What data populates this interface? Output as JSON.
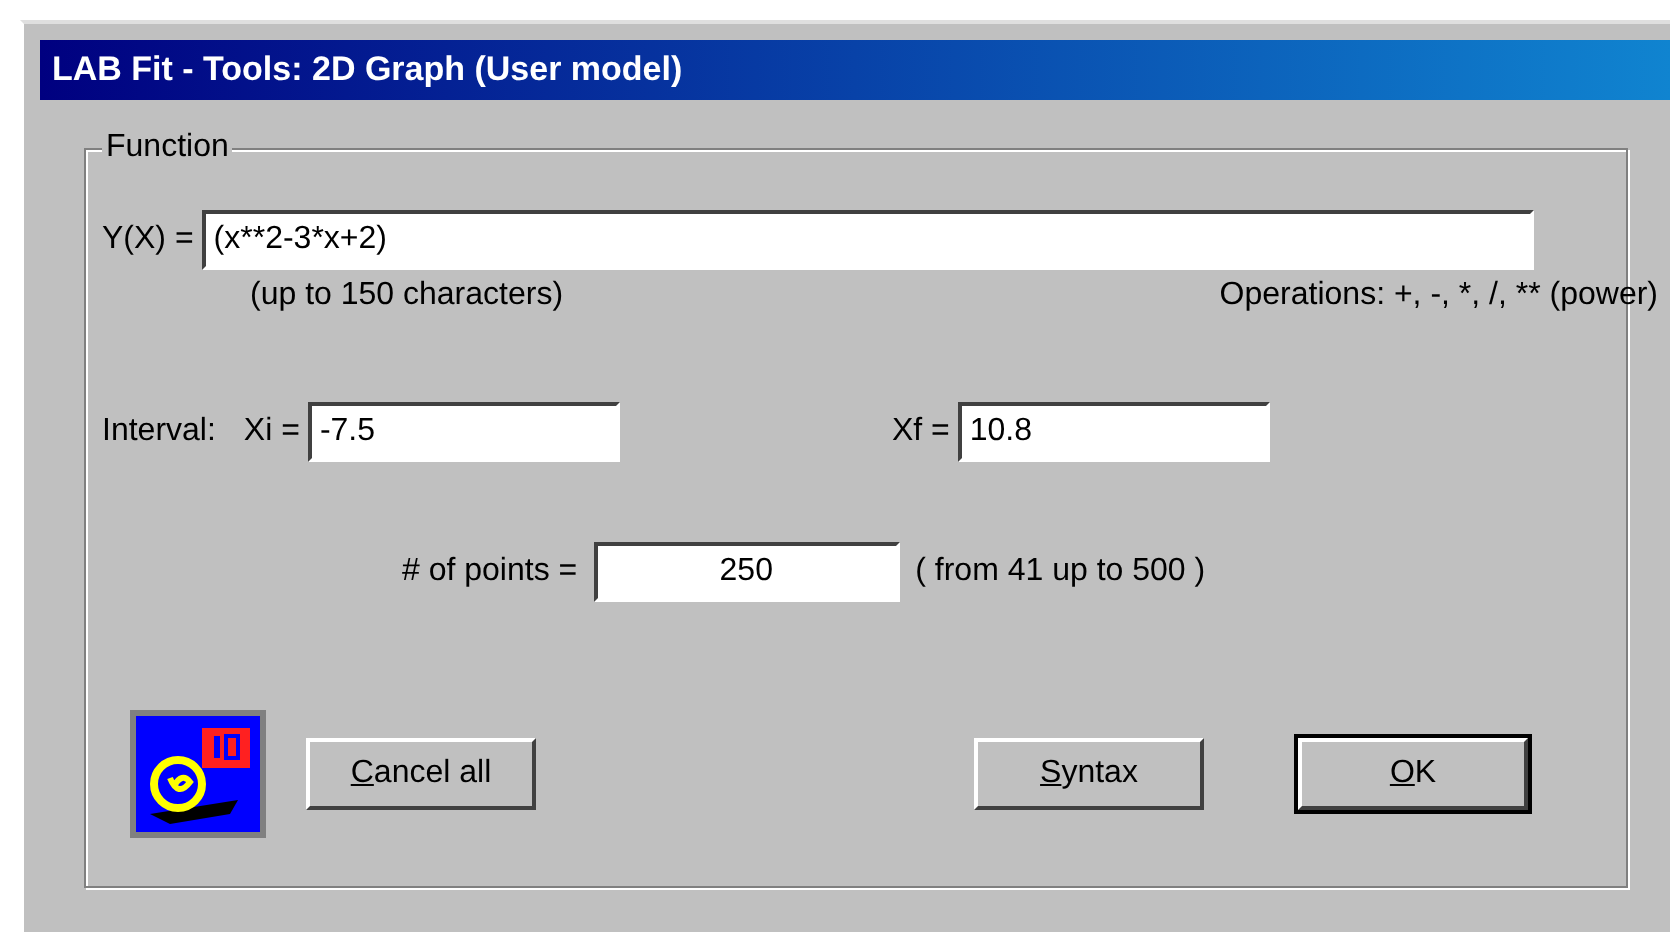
{
  "window": {
    "title": "LAB Fit - Tools: 2D Graph (User model)"
  },
  "group": {
    "label": "Function"
  },
  "function_field": {
    "label": "Y(X) =",
    "value": "(x**2-3*x+2)",
    "hint": "(up to 150 characters)",
    "operations": "Operations:  +,  -,  *,  /,  ** (power)"
  },
  "interval": {
    "label": "Interval:",
    "xi_label": "Xi =",
    "xi_value": "-7.5",
    "xf_label": "Xf =",
    "xf_value": "10.8"
  },
  "points": {
    "label": "# of points =",
    "value": "250",
    "range": "( from 41 up to 500 )"
  },
  "buttons": [
    {
      "label": "Cancel all",
      "default": false
    },
    {
      "label": "Syntax",
      "default": false
    },
    {
      "label": "OK",
      "default": true
    }
  ]
}
